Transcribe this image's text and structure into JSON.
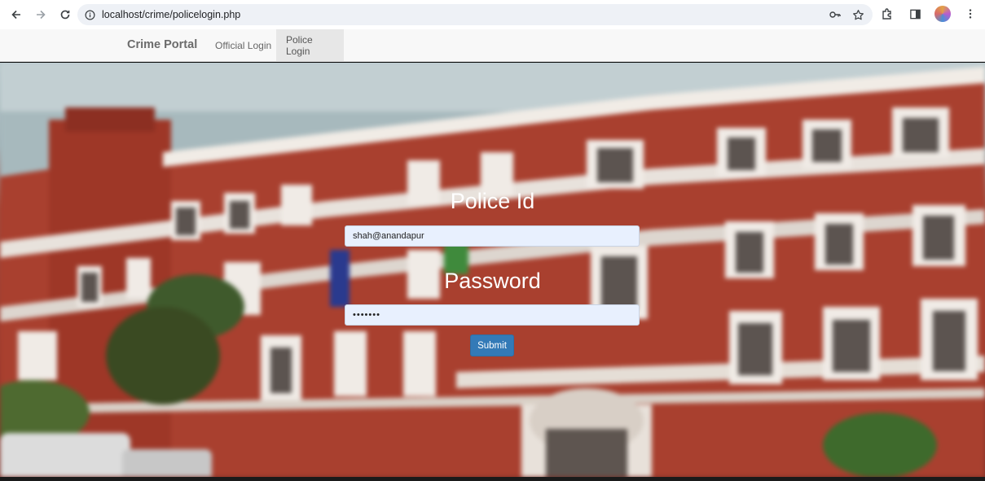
{
  "browser": {
    "url": "localhost/crime/policelogin.php"
  },
  "navbar": {
    "brand": "Crime Portal",
    "links": [
      {
        "label": "Official Login",
        "active": false
      },
      {
        "label": "Police Login",
        "active": true
      }
    ]
  },
  "form": {
    "police_id_label": "Police Id",
    "police_id_value": "shah@anandapur",
    "password_label": "Password",
    "password_value": "•••••••",
    "submit_label": "Submit"
  },
  "colors": {
    "primary_button": "#337ab7",
    "navbar_bg": "#f8f8f8",
    "active_tab_bg": "#e7e7e7"
  }
}
